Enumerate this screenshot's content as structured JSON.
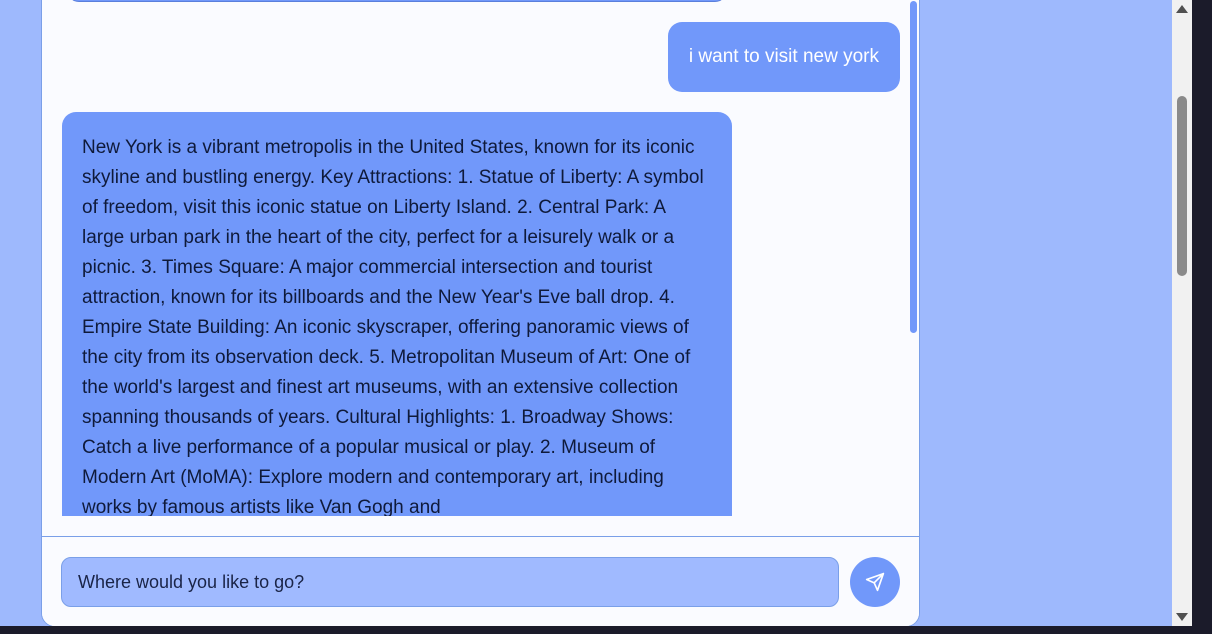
{
  "chat": {
    "messages": [
      {
        "role": "user",
        "text": "i want to visit new york"
      },
      {
        "role": "assistant",
        "text": "New York is a vibrant metropolis in the United States, known for its iconic skyline and bustling energy. Key Attractions: 1. Statue of Liberty: A symbol of freedom, visit this iconic statue on Liberty Island. 2. Central Park: A large urban park in the heart of the city, perfect for a leisurely walk or a picnic. 3. Times Square: A major commercial intersection and tourist attraction, known for its billboards and the New Year's Eve ball drop. 4. Empire State Building: An iconic skyscraper, offering panoramic views of the city from its observation deck. 5. Metropolitan Museum of Art: One of the world's largest and finest art museums, with an extensive collection spanning thousands of years. Cultural Highlights: 1. Broadway Shows: Catch a live performance of a popular musical or play. 2. Museum of Modern Art (MoMA): Explore modern and contemporary art, including works by famous artists like Van Gogh and"
      }
    ]
  },
  "composer": {
    "placeholder": "Where would you like to go?",
    "value": ""
  },
  "icons": {
    "send": "paper-plane-icon"
  },
  "colors": {
    "page_background": "#9eb9fd",
    "card_background": "#fafbff",
    "bubble": "#7198fa",
    "input_background": "#a0baff",
    "border": "#7a9fe8"
  }
}
